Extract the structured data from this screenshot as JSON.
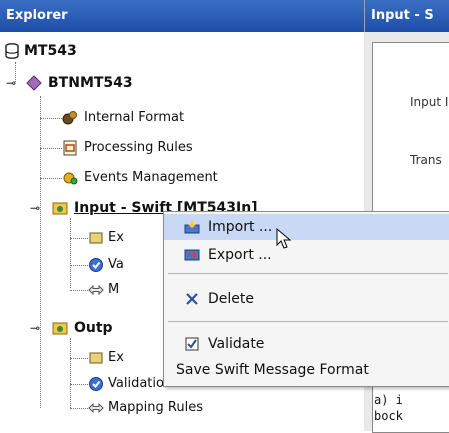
{
  "explorer": {
    "title": "Explorer",
    "tree": {
      "root": "MT543",
      "btnmt": "BTNMT543",
      "internal_format": "Internal Format",
      "processing_rules": "Processing Rules",
      "events_management": "Events Management",
      "input_swift": "Input - Swift [MT543In]",
      "input_child_1": "Ex",
      "input_child_2": "Va",
      "input_child_3": "M",
      "output": "Outp",
      "output_child_1": "Ex",
      "output_child_2": "Validation Rules",
      "output_child_3": "Mapping Rules"
    }
  },
  "right_panel": {
    "title": "Input - S",
    "label_input": "Input I",
    "label_trans": "Trans",
    "mono_line1": "a) i",
    "mono_line2": "bock"
  },
  "context_menu": {
    "import": "Import ...",
    "export": "Export ...",
    "delete": "Delete",
    "validate": "Validate",
    "save_format": "Save Swift Message Format"
  },
  "colors": {
    "title_bar": "#2a5cb6",
    "menu_highlight": "#c9d8f4"
  }
}
